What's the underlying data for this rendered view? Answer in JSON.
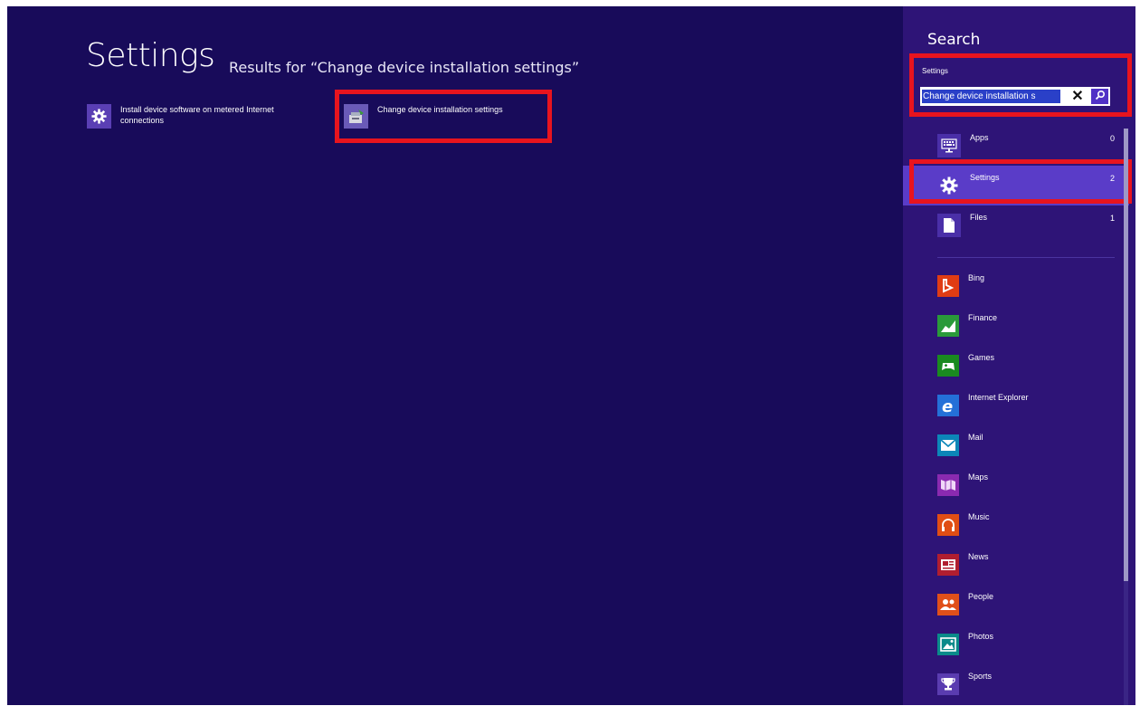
{
  "main": {
    "title": "Settings",
    "subtitle": "Results for “Change device installation settings”",
    "results": [
      {
        "label": "Install device software on metered Internet connections",
        "icon": "gear-icon"
      },
      {
        "label": "Change device installation settings",
        "icon": "device-installation-icon"
      }
    ]
  },
  "pane": {
    "title": "Search",
    "scope": "Settings",
    "query": "Change device installation s",
    "clear_glyph": "✕",
    "categories": [
      {
        "label": "Apps",
        "count": "0",
        "icon": "keyboard-icon"
      },
      {
        "label": "Settings",
        "count": "2",
        "icon": "gear-icon"
      },
      {
        "label": "Files",
        "count": "1",
        "icon": "file-icon"
      }
    ],
    "apps": [
      {
        "label": "Bing",
        "icon": "bing-icon",
        "color": "#e03c14"
      },
      {
        "label": "Finance",
        "icon": "finance-icon",
        "color": "#2a9a3a"
      },
      {
        "label": "Games",
        "icon": "games-icon",
        "color": "#1a8a20"
      },
      {
        "label": "Internet Explorer",
        "icon": "internet-explorer-icon",
        "color": "#2470d8"
      },
      {
        "label": "Mail",
        "icon": "mail-icon",
        "color": "#0c86b8"
      },
      {
        "label": "Maps",
        "icon": "maps-icon",
        "color": "#8a2ab0"
      },
      {
        "label": "Music",
        "icon": "music-icon",
        "color": "#e04e14"
      },
      {
        "label": "News",
        "icon": "news-icon",
        "color": "#b01e30"
      },
      {
        "label": "People",
        "icon": "people-icon",
        "color": "#e0501a"
      },
      {
        "label": "Photos",
        "icon": "photos-icon",
        "color": "#0a8a8a"
      },
      {
        "label": "Sports",
        "icon": "sports-icon",
        "color": "#5a3cb0"
      }
    ]
  },
  "colors": {
    "background": "#180b5a",
    "pane": "#2e1477",
    "selected": "#5a3cc8",
    "highlight": "#e8141e"
  }
}
